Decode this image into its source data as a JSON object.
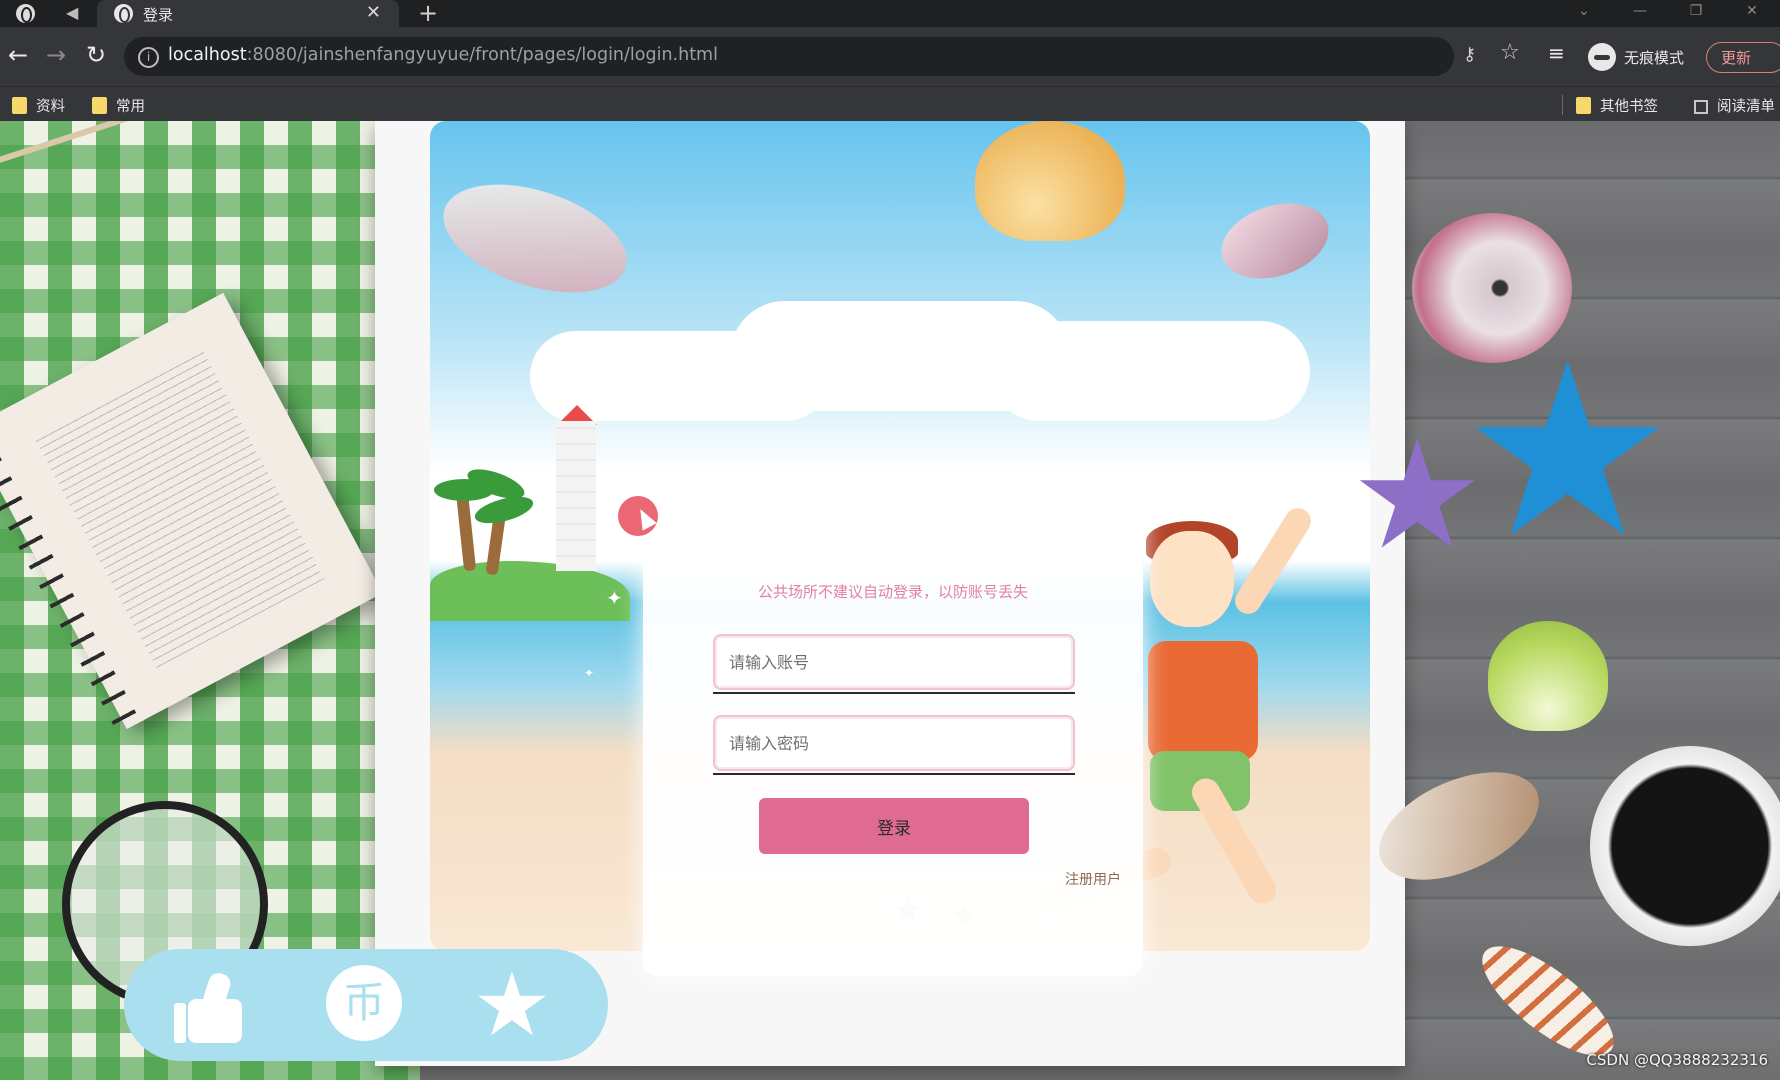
{
  "browser": {
    "tab_title": "登录",
    "tab_close": "✕",
    "new_tab": "+",
    "url_host": "localhost",
    "url_rest": ":8080/jainshenfangyuyue/front/pages/login/login.html",
    "incognito_label": "无痕模式",
    "update_label": "更新",
    "bookmarks": [
      {
        "label": "资料"
      },
      {
        "label": "常用"
      }
    ],
    "other_bookmarks": "其他书签",
    "reading_list": "阅读清单"
  },
  "login": {
    "notice": "公共场所不建议自动登录，以防账号丢失",
    "account_placeholder": "请输入账号",
    "password_placeholder": "请输入密码",
    "login_button": "登录",
    "register_link": "注册用户"
  },
  "actions": {
    "like_icon": "thumbs-up-icon",
    "coin_glyph": "币",
    "favorite_glyph": "★"
  },
  "watermark": "CSDN @QQ3888232316",
  "colors": {
    "accent_pink": "#df6b93",
    "notice_pink": "#e57fa0",
    "action_bar": "#a9dfee"
  }
}
